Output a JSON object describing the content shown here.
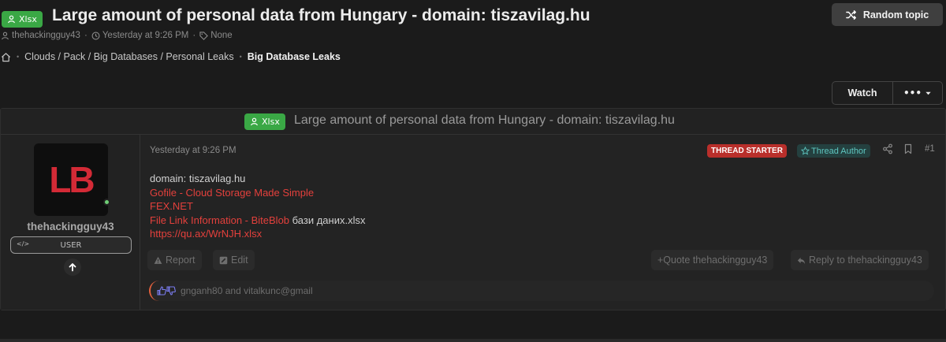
{
  "thread": {
    "prefix": "Xlsx",
    "title": "Large amount of personal data from Hungary - domain: tiszavilag.hu",
    "author": "thehackingguy43",
    "date": "Yesterday at 9:26 PM",
    "tags": "None",
    "meta_sep": "·"
  },
  "header": {
    "random_topic_label": "Random topic"
  },
  "breadcrumb": {
    "items": [
      "Clouds / Pack / Big Databases / Personal Leaks",
      "Big Database Leaks"
    ],
    "separator": "•"
  },
  "toolbar": {
    "watch_label": "Watch",
    "more_label": "•••"
  },
  "post": {
    "header_prefix": "Xlsx",
    "header_title": "Large amount of personal data from Hungary - domain: tiszavilag.hu",
    "user": {
      "avatar_text": "LB",
      "username": "thehackingguy43",
      "role": "USER",
      "role_icon": "</>"
    },
    "date": "Yesterday at 9:26 PM",
    "starter_badge": "THREAD STARTER",
    "author_badge": "Thread Author",
    "number": "#1",
    "body": {
      "line1": "domain: tiszavilag.hu",
      "link1": "Gofile - Cloud Storage Made Simple",
      "link2": "FEX.NET",
      "link3": "File Link Information - BiteBlob",
      "line4_suffix": " бази даних.xlsx",
      "link4": "https://qu.ax/WrNJH.xlsx"
    },
    "actions": {
      "report": "Report",
      "edit": "Edit",
      "quote": "+Quote thehackingguy43",
      "reply": "Reply to thehackingguy43"
    },
    "reactions": "gnganh80 and vitalkunc@gmail"
  },
  "colors": {
    "prefix_green": "#3aa845",
    "link_red": "#e3403c",
    "starter_red": "#b92f2b",
    "author_teal": "#5fc7c1",
    "online_green": "#6fcf76"
  },
  "icons": [
    "user-icon",
    "shuffle-icon",
    "clock-icon",
    "tag-icon",
    "home-icon",
    "chevron-down-icon",
    "star-icon",
    "share-icon",
    "bookmark-icon",
    "warning-icon",
    "edit-icon",
    "reply-icon",
    "thumbs-up-icon",
    "thumbs-down-icon",
    "arrow-up-icon",
    "code-icon"
  ]
}
